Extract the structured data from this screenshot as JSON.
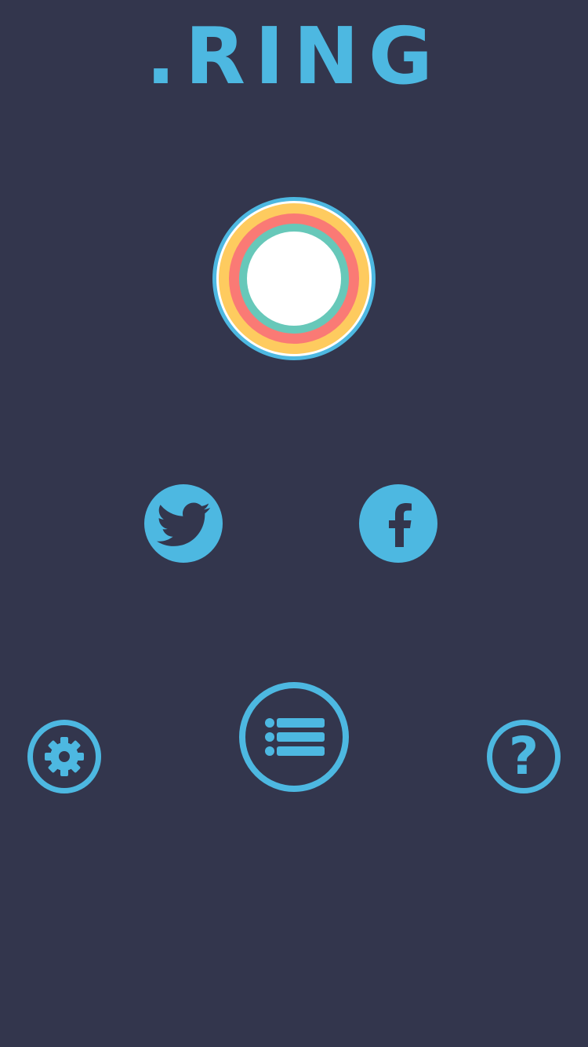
{
  "app": {
    "title": ".RING"
  },
  "colors": {
    "background": "#33364d",
    "accent": "#4db8e1",
    "ring_outer": "#4db8e1",
    "ring_yellow": "#fecb5f",
    "ring_red": "#fa7a75",
    "ring_teal": "#67c8b9",
    "ring_center": "#ffffff"
  },
  "buttons": {
    "twitter": {
      "icon": "twitter-bird-icon"
    },
    "facebook": {
      "icon": "facebook-f-icon"
    },
    "settings": {
      "icon": "gear-icon"
    },
    "menu": {
      "icon": "list-icon"
    },
    "help": {
      "icon": "question-mark-icon",
      "glyph": "?"
    }
  }
}
